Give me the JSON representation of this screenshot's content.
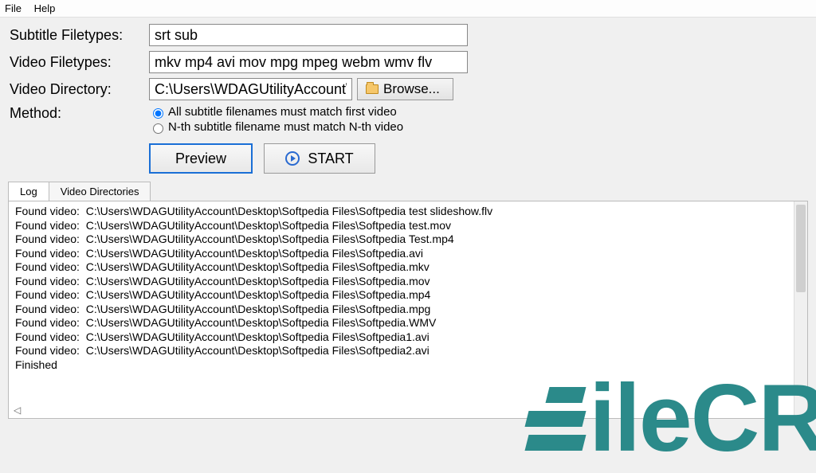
{
  "menu": {
    "file": "File",
    "help": "Help"
  },
  "labels": {
    "subtitle_types": "Subtitle Filetypes:",
    "video_types": "Video Filetypes:",
    "video_dir": "Video Directory:",
    "method": "Method:"
  },
  "inputs": {
    "subtitle_types": "srt sub",
    "video_types": "mkv mp4 avi mov mpg mpeg webm wmv flv",
    "video_dir": "C:\\Users\\WDAGUtilityAccount\\"
  },
  "buttons": {
    "browse": "Browse...",
    "preview": "Preview",
    "start": "START"
  },
  "method": {
    "opt1": "All subtitle filenames must match first video",
    "opt2": "N-th subtitle filename must match N-th video",
    "selected": "opt1"
  },
  "tabs": {
    "log": "Log",
    "dirs": "Video Directories",
    "active": "log"
  },
  "log_lines": [
    "Found video:  C:\\Users\\WDAGUtilityAccount\\Desktop\\Softpedia Files\\Softpedia test slideshow.flv",
    "Found video:  C:\\Users\\WDAGUtilityAccount\\Desktop\\Softpedia Files\\Softpedia test.mov",
    "Found video:  C:\\Users\\WDAGUtilityAccount\\Desktop\\Softpedia Files\\Softpedia Test.mp4",
    "Found video:  C:\\Users\\WDAGUtilityAccount\\Desktop\\Softpedia Files\\Softpedia.avi",
    "Found video:  C:\\Users\\WDAGUtilityAccount\\Desktop\\Softpedia Files\\Softpedia.mkv",
    "Found video:  C:\\Users\\WDAGUtilityAccount\\Desktop\\Softpedia Files\\Softpedia.mov",
    "Found video:  C:\\Users\\WDAGUtilityAccount\\Desktop\\Softpedia Files\\Softpedia.mp4",
    "Found video:  C:\\Users\\WDAGUtilityAccount\\Desktop\\Softpedia Files\\Softpedia.mpg",
    "Found video:  C:\\Users\\WDAGUtilityAccount\\Desktop\\Softpedia Files\\Softpedia.WMV",
    "Found video:  C:\\Users\\WDAGUtilityAccount\\Desktop\\Softpedia Files\\Softpedia1.avi",
    "Found video:  C:\\Users\\WDAGUtilityAccount\\Desktop\\Softpedia Files\\Softpedia2.avi",
    "Finished"
  ],
  "watermark": {
    "text": "ileCR"
  }
}
